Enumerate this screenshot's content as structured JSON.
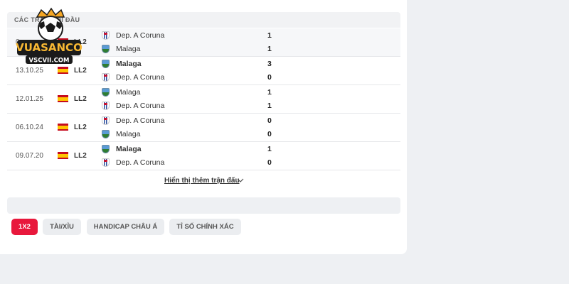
{
  "header": {
    "title": "Các trận đối đầu"
  },
  "rows": [
    {
      "date": "0",
      "league": "LL2",
      "teams": [
        {
          "name": "Dep. A Coruna",
          "crest": "dep",
          "bold": false,
          "score": "1"
        },
        {
          "name": "Malaga",
          "crest": "mal",
          "bold": false,
          "score": "1"
        }
      ],
      "highlight": true
    },
    {
      "date": "13.10.25",
      "league": "LL2",
      "teams": [
        {
          "name": "Malaga",
          "crest": "mal",
          "bold": true,
          "score": "3"
        },
        {
          "name": "Dep. A Coruna",
          "crest": "dep",
          "bold": false,
          "score": "0"
        }
      ]
    },
    {
      "date": "12.01.25",
      "league": "LL2",
      "teams": [
        {
          "name": "Malaga",
          "crest": "mal",
          "bold": false,
          "score": "1"
        },
        {
          "name": "Dep. A Coruna",
          "crest": "dep",
          "bold": false,
          "score": "1"
        }
      ]
    },
    {
      "date": "06.10.24",
      "league": "LL2",
      "teams": [
        {
          "name": "Dep. A Coruna",
          "crest": "dep",
          "bold": false,
          "score": "0"
        },
        {
          "name": "Malaga",
          "crest": "mal",
          "bold": false,
          "score": "0"
        }
      ]
    },
    {
      "date": "09.07.20",
      "league": "LL2",
      "teams": [
        {
          "name": "Malaga",
          "crest": "mal",
          "bold": true,
          "score": "1"
        },
        {
          "name": "Dep. A Coruna",
          "crest": "dep",
          "bold": false,
          "score": "0"
        }
      ]
    }
  ],
  "show_more": {
    "label": "Hiển thị thêm trận đấu",
    "icon": "chevron-down-icon"
  },
  "tabs": [
    {
      "label": "1X2",
      "active": true
    },
    {
      "label": "Tài/Xỉu",
      "active": false
    },
    {
      "label": "Handicap châu Á",
      "active": false
    },
    {
      "label": "Tỉ số chính xác",
      "active": false
    }
  ],
  "logo": {
    "text": "VUASANCO",
    "subtext": "VSCVII.COM"
  },
  "colors": {
    "accent": "#e8183c",
    "flag_red": "#c60b1e",
    "flag_yellow": "#ffc400"
  }
}
